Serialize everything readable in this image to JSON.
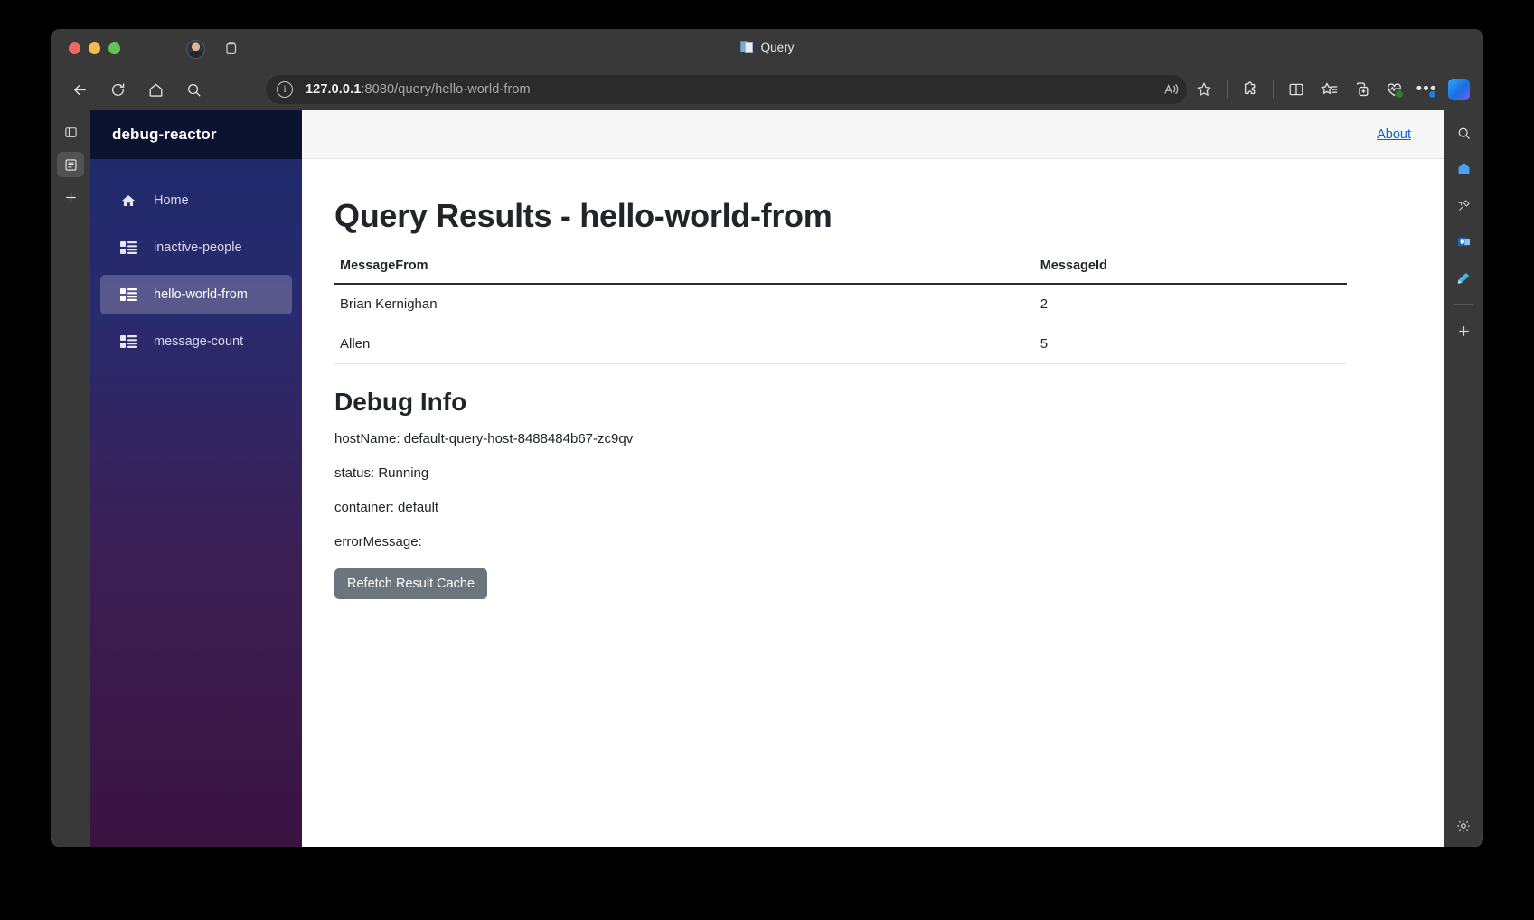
{
  "browser": {
    "tab_title": "Query",
    "tab_favicon": "document-icon",
    "url_host": "127.0.0.1",
    "url_rest": ":8080/query/hello-world-from",
    "nav": {
      "back": "back-icon",
      "refresh": "refresh-icon",
      "home": "home-icon",
      "search": "search-icon"
    },
    "toolbar_right": {
      "read_aloud": "read-aloud-icon",
      "favorite": "star-icon",
      "extensions": "extensions-puzzle-icon",
      "split_screen": "split-screen-icon",
      "collections": "collections-icon",
      "add_tab_group": "add-tab-group-icon",
      "settings_more": "more-options-icon",
      "copilot": "copilot-icon"
    },
    "left_rail": [
      "tab-actions-icon",
      "page-reader-icon",
      "add-icon"
    ],
    "right_rail": [
      "search-icon",
      "shopping-icon",
      "tools-icon",
      "outlook-icon",
      "paint-icon",
      "add-icon",
      "settings-gear-icon"
    ]
  },
  "sidebar": {
    "brand": "debug-reactor",
    "items": [
      {
        "label": "Home",
        "icon": "home-icon",
        "active": false
      },
      {
        "label": "inactive-people",
        "icon": "table-list-icon",
        "active": false
      },
      {
        "label": "hello-world-from",
        "icon": "table-list-icon",
        "active": true
      },
      {
        "label": "message-count",
        "icon": "table-list-icon",
        "active": false
      }
    ]
  },
  "topbar": {
    "about_label": "About"
  },
  "page": {
    "title": "Query Results - hello-world-from",
    "table": {
      "columns": [
        "MessageFrom",
        "MessageId"
      ],
      "rows": [
        {
          "MessageFrom": "Brian Kernighan",
          "MessageId": "2"
        },
        {
          "MessageFrom": "Allen",
          "MessageId": "5"
        }
      ]
    },
    "debug": {
      "title": "Debug Info",
      "hostName": "hostName: default-query-host-8488484b67-zc9qv",
      "status": "status: Running",
      "container": "container: default",
      "errorMessage": "errorMessage:",
      "refetch_label": "Refetch Result Cache"
    }
  },
  "colors": {
    "accent_link": "#0366d6",
    "sidebar_brand_bg": "#0c1331",
    "button_secondary": "#6c757d"
  }
}
